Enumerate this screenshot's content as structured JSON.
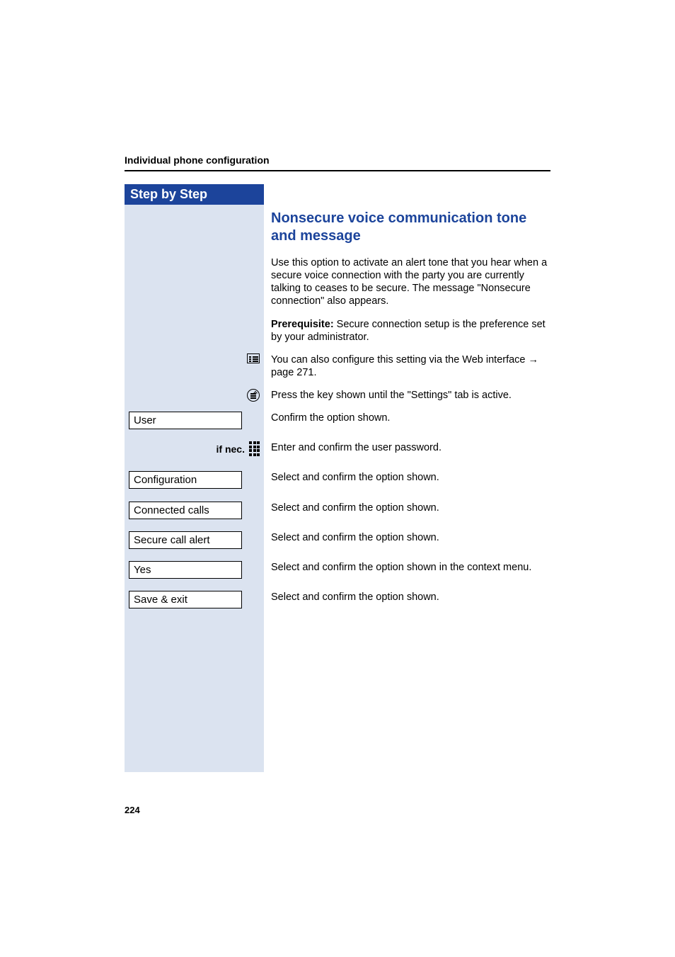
{
  "header": {
    "title": "Individual phone configuration"
  },
  "sidebar": {
    "title": "Step by Step"
  },
  "section": {
    "heading": "Nonsecure voice communication tone and message",
    "intro": "Use this option to activate an alert tone that you hear when a secure voice connection with the party you are currently talking to ceases to be secure. The message \"Nonsecure connection\" also appears.",
    "prereq_label": "Prerequisite:",
    "prereq_text": " Secure connection setup is the preference set by your administrator.",
    "web_note": "You can also configure this setting via the Web interface ",
    "web_link": "→ page 271.",
    "steps": [
      {
        "icon": "settings",
        "text": "Press the key shown until the \"Settings\" tab is active."
      },
      {
        "field": "User",
        "text": "Confirm the option shown."
      },
      {
        "ifnec": true,
        "ifnec_label": "if nec.",
        "text": "Enter and confirm the user password."
      },
      {
        "field": "Configuration",
        "text": "Select and confirm the option shown."
      },
      {
        "field": "Connected calls",
        "text": "Select and confirm the option shown."
      },
      {
        "field": "Secure call alert",
        "text": "Select and confirm the option shown."
      },
      {
        "field": "Yes",
        "text": "Select and confirm the option shown in the context menu."
      },
      {
        "field": "Save & exit",
        "text": "Select and confirm the option shown."
      }
    ]
  },
  "page_number": "224"
}
